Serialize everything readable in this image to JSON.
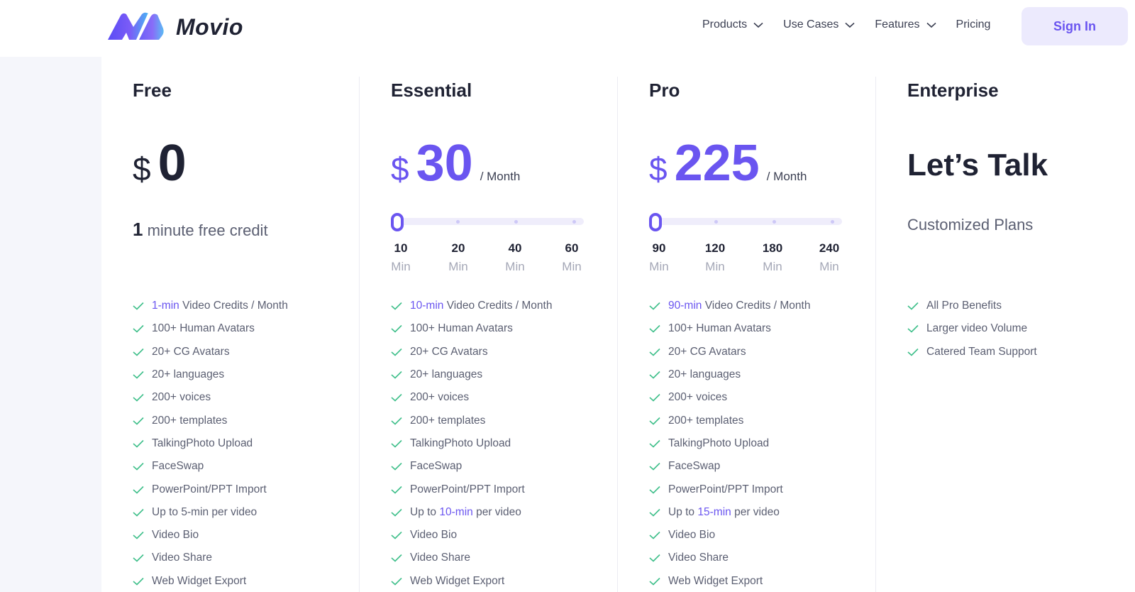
{
  "header": {
    "brand": "Movio",
    "nav": [
      {
        "label": "Products",
        "has_dropdown": true
      },
      {
        "label": "Use Cases",
        "has_dropdown": true
      },
      {
        "label": "Features",
        "has_dropdown": true
      },
      {
        "label": "Pricing",
        "has_dropdown": false
      }
    ],
    "signin_label": "Sign In"
  },
  "colors": {
    "accent": "#6a55f0",
    "check": "#3fbf8a",
    "text_dark": "#1f2233",
    "text_muted": "#5b5f72"
  },
  "plans": {
    "free": {
      "name": "Free",
      "currency": "$",
      "amount": "0",
      "credit_value": "1",
      "credit_text": "minute free credit",
      "features": [
        "Video Credits / Month",
        "100+ Human Avatars",
        "20+ CG Avatars",
        "20+ languages",
        "200+ voices",
        "200+ templates",
        "TalkingPhoto Upload",
        "FaceSwap",
        "PowerPoint/PPT Import",
        "Up to 5-min per video",
        "Video Bio",
        "Video Share",
        "Web Widget Export"
      ],
      "credits_highlight": "1-min"
    },
    "essential": {
      "name": "Essential",
      "currency": "$",
      "amount": "30",
      "period": "/ Month",
      "slider_selected_index": 0,
      "stops": [
        {
          "value": "10",
          "unit": "Min"
        },
        {
          "value": "20",
          "unit": "Min"
        },
        {
          "value": "40",
          "unit": "Min"
        },
        {
          "value": "60",
          "unit": "Min"
        }
      ],
      "credits_highlight": "10-min",
      "features": [
        "Video Credits / Month",
        "100+ Human Avatars",
        "20+ CG Avatars",
        "20+ languages",
        "200+ voices",
        "200+ templates",
        "TalkingPhoto Upload",
        "FaceSwap",
        "PowerPoint/PPT Import",
        "Up to",
        "per video",
        "Video Bio",
        "Video Share",
        "Web Widget Export"
      ],
      "length_highlight": "10-min"
    },
    "pro": {
      "name": "Pro",
      "currency": "$",
      "amount": "225",
      "period": "/ Month",
      "slider_selected_index": 0,
      "stops": [
        {
          "value": "90",
          "unit": "Min"
        },
        {
          "value": "120",
          "unit": "Min"
        },
        {
          "value": "180",
          "unit": "Min"
        },
        {
          "value": "240",
          "unit": "Min"
        }
      ],
      "credits_highlight": "90-min",
      "features": [
        "Video Credits / Month",
        "100+ Human Avatars",
        "20+ CG Avatars",
        "20+ languages",
        "200+ voices",
        "200+ templates",
        "TalkingPhoto Upload",
        "FaceSwap",
        "PowerPoint/PPT Import",
        "Up to",
        "per video",
        "Video Bio",
        "Video Share",
        "Web Widget Export"
      ],
      "length_highlight": "15-min"
    },
    "enterprise": {
      "name": "Enterprise",
      "headline": "Let’s Talk",
      "subtitle": "Customized Plans",
      "features": [
        "All Pro Benefits",
        "Larger video Volume",
        "Catered Team Support"
      ]
    }
  }
}
